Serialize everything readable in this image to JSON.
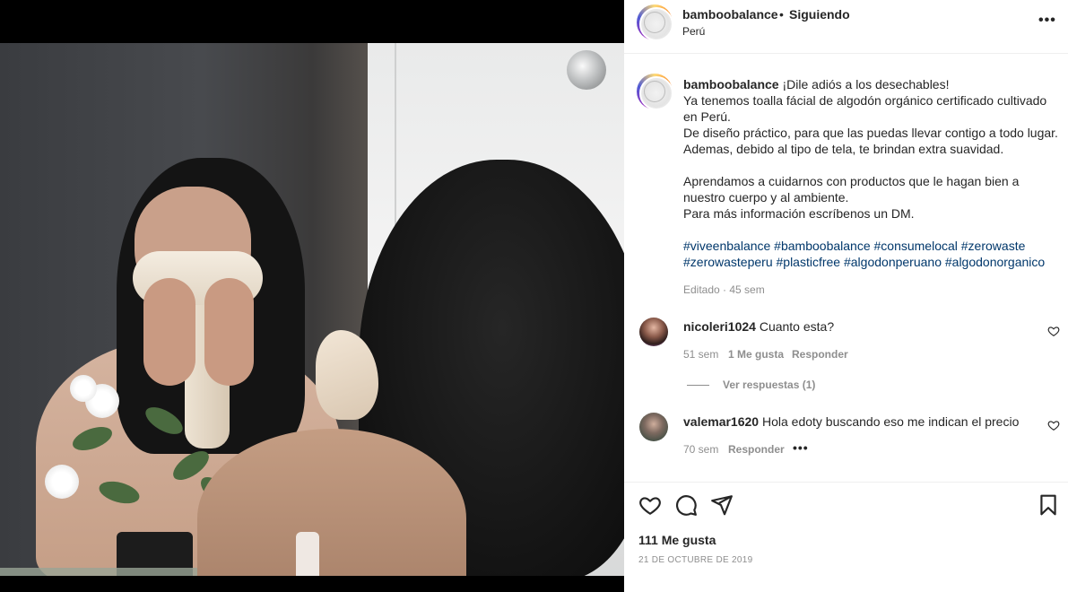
{
  "post": {
    "username": "bamboobalance",
    "separator": "•",
    "follow_status": "Siguiendo",
    "location": "Perú",
    "more_icon": "more-horizontal-icon"
  },
  "caption": {
    "username": "bamboobalance",
    "line1": "¡Dile adiós a los desechables!",
    "line2": "Ya tenemos toalla fácial de algodón orgánico certificado cultivado",
    "line3": "en Perú.",
    "line4": "De diseño práctico, para que las puedas llevar contigo a todo lugar.",
    "line5": "Ademas, debido al tipo de tela, te brindan extra suavidad.",
    "line6": "Aprendamos a cuidarnos con productos que le hagan bien a",
    "line7": "nuestro cuerpo y al ambiente.",
    "line8": "Para más información escríbenos un DM.",
    "hashtags_line1": "#viveenbalance #bamboobalance #consumelocal #zerowaste",
    "hashtags_line2": "#zerowasteperu #plasticfree #algodonperuano #algodonorganico",
    "meta": "Editado · 45 sem"
  },
  "comments": [
    {
      "username": "nicoleri1024",
      "text": "Cuanto esta?",
      "time": "51 sem",
      "likes": "1 Me gusta",
      "reply": "Responder",
      "view_replies": "Ver respuestas (1)"
    },
    {
      "username": "valemar1620",
      "text": "Hola edoty buscando eso me indican el precio",
      "time": "70 sem",
      "reply": "Responder",
      "more": "•••"
    }
  ],
  "footer": {
    "likes": "111 Me gusta",
    "date": "21 DE OCTUBRE DE 2019"
  },
  "colors": {
    "text": "#262626",
    "secondary": "#8e8e8e",
    "hashtag": "#00376b",
    "divider": "#efefef"
  }
}
